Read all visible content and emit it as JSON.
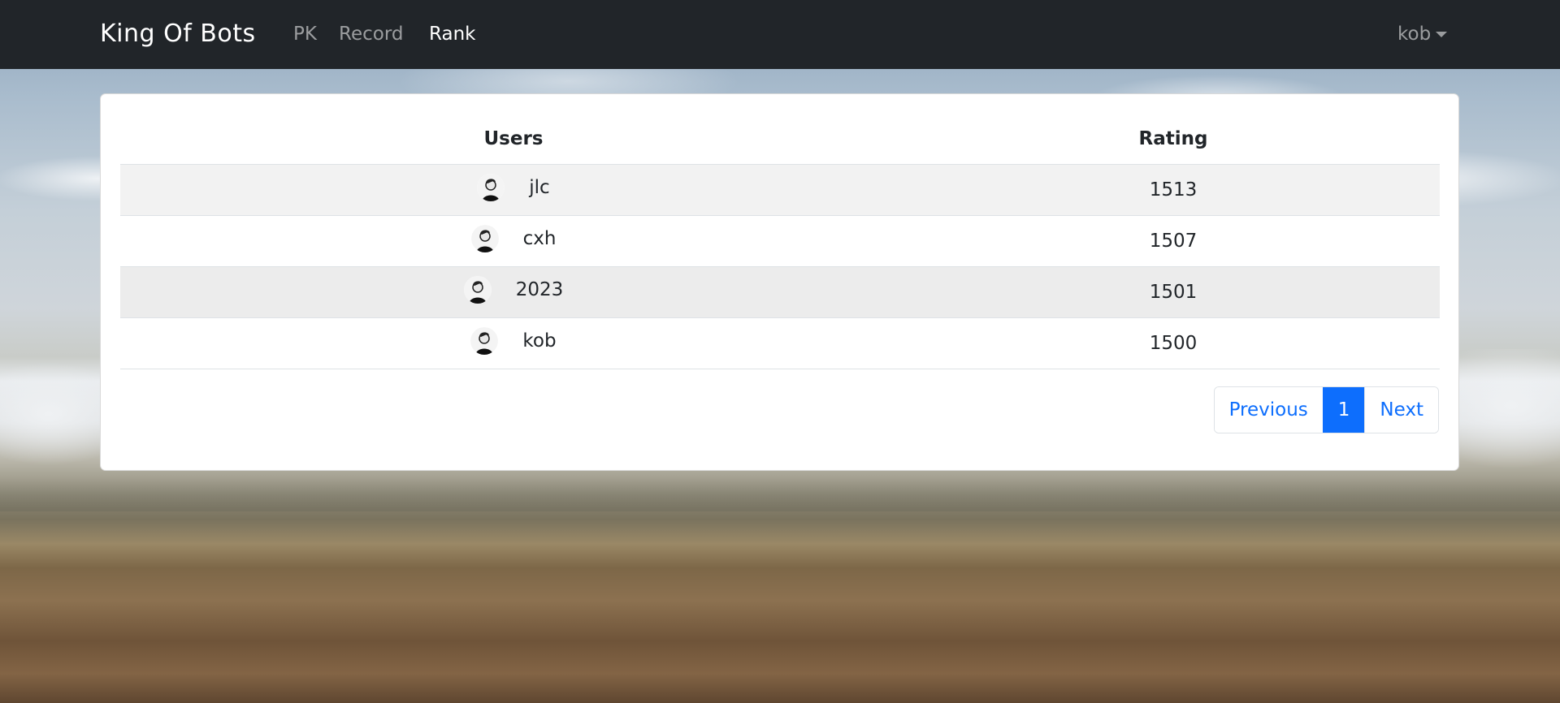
{
  "navbar": {
    "brand": "King Of Bots",
    "links": [
      {
        "label": "PK"
      },
      {
        "label": "Record"
      },
      {
        "label": "Rank"
      }
    ],
    "user_menu": "kob"
  },
  "table": {
    "headers": {
      "users": "Users",
      "rating": "Rating"
    },
    "rows": [
      {
        "user": "jlc",
        "rating": "1513"
      },
      {
        "user": "cxh",
        "rating": "1507"
      },
      {
        "user": "2023",
        "rating": "1501"
      },
      {
        "user": "kob",
        "rating": "1500"
      }
    ]
  },
  "pagination": {
    "previous": "Previous",
    "current_page": "1",
    "next": "Next"
  },
  "colors": {
    "navbar_bg": "#212529",
    "accent": "#0d6efd"
  }
}
